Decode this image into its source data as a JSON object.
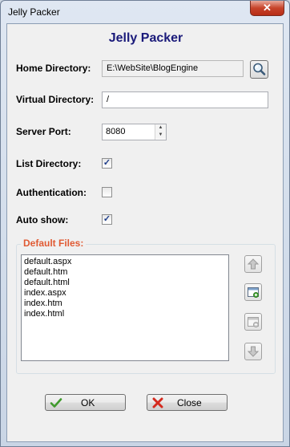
{
  "window": {
    "title": "Jelly Packer",
    "close_glyph": "✕"
  },
  "app_title": "Jelly Packer",
  "fields": {
    "home_directory": {
      "label": "Home Directory:",
      "value": "E:\\WebSite\\BlogEngine"
    },
    "virtual_directory": {
      "label": "Virtual Directory:",
      "value": "/"
    },
    "server_port": {
      "label": "Server Port:",
      "value": "8080"
    }
  },
  "checkboxes": {
    "list_directory": {
      "label": "List Directory:",
      "checked": true
    },
    "authentication": {
      "label": "Authentication:",
      "checked": false
    },
    "auto_show": {
      "label": "Auto show:",
      "checked": true
    }
  },
  "default_files": {
    "title": "Default Files:",
    "items": [
      "default.aspx",
      "default.htm",
      "default.html",
      "index.aspx",
      "index.htm",
      "index.html"
    ]
  },
  "side_buttons": [
    "arrow-up-icon",
    "add-file-icon",
    "remove-file-icon",
    "arrow-down-icon"
  ],
  "buttons": {
    "ok": "OK",
    "close": "Close"
  },
  "icons": {
    "browse": "magnifier-icon",
    "ok": "checkmark-icon",
    "close": "red-x-icon"
  },
  "colors": {
    "app_title": "#1a1a7a",
    "group_title": "#e05a33",
    "check": "#1e3d8a"
  }
}
